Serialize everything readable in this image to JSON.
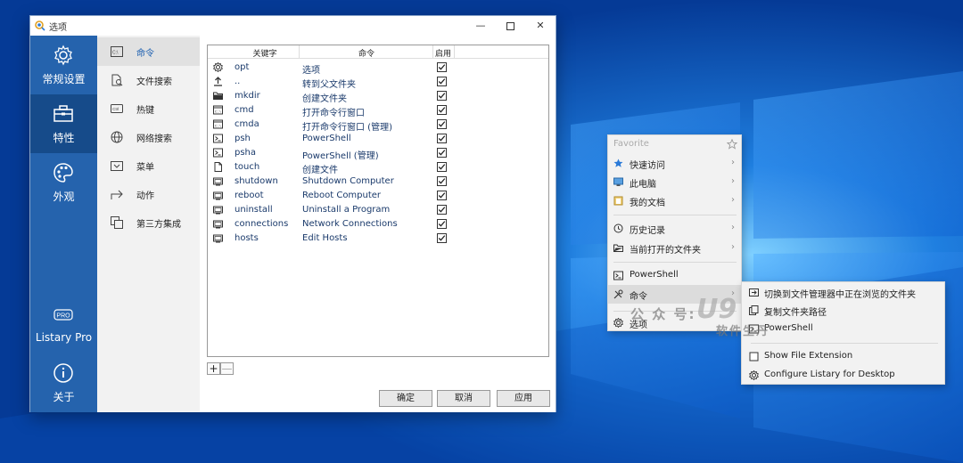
{
  "window": {
    "title": "选项",
    "controls": {
      "minimize": "—",
      "close": "✕"
    }
  },
  "main_nav": [
    {
      "label": "常规设置",
      "icon": "gear-icon"
    },
    {
      "label": "特性",
      "icon": "toolbox-icon",
      "active": true
    },
    {
      "label": "外观",
      "icon": "palette-icon"
    },
    {
      "label": "Listary Pro",
      "icon": "pro-badge-icon"
    },
    {
      "label": "关于",
      "icon": "info-icon"
    }
  ],
  "pro_badge": "PRO",
  "sub_nav": [
    {
      "label": "命令",
      "icon": "command-icon",
      "active": true
    },
    {
      "label": "文件搜索",
      "icon": "file-search-icon"
    },
    {
      "label": "热键",
      "icon": "hotkey-icon"
    },
    {
      "label": "网络搜索",
      "icon": "globe-icon"
    },
    {
      "label": "菜单",
      "icon": "menu-icon"
    },
    {
      "label": "动作",
      "icon": "action-icon"
    },
    {
      "label": "第三方集成",
      "icon": "integration-icon"
    }
  ],
  "subnav_icon_text": {
    "command": "C:\\",
    "hotkey": "Ctrl"
  },
  "table": {
    "headers": {
      "keyword": "关键字",
      "command": "命令",
      "enabled": "启用"
    },
    "rows": [
      {
        "keyword": "opt",
        "command": "选项",
        "icon": "gear-icon",
        "enabled": true
      },
      {
        "keyword": "..",
        "command": "转到父文件夹",
        "icon": "up-arrow-icon",
        "enabled": true
      },
      {
        "keyword": "mkdir",
        "command": "创建文件夹",
        "icon": "folder-icon",
        "enabled": true
      },
      {
        "keyword": "cmd",
        "command": "打开命令行窗口",
        "icon": "terminal-icon",
        "enabled": true
      },
      {
        "keyword": "cmda",
        "command": "打开命令行窗口 (管理)",
        "icon": "terminal-icon",
        "enabled": true
      },
      {
        "keyword": "psh",
        "command": "PowerShell",
        "icon": "powershell-icon",
        "enabled": true
      },
      {
        "keyword": "psha",
        "command": "PowerShell (管理)",
        "icon": "powershell-icon",
        "enabled": true
      },
      {
        "keyword": "touch",
        "command": "创建文件",
        "icon": "file-icon",
        "enabled": true
      },
      {
        "keyword": "shutdown",
        "command": "Shutdown Computer",
        "icon": "system-icon",
        "enabled": true
      },
      {
        "keyword": "reboot",
        "command": "Reboot Computer",
        "icon": "system-icon",
        "enabled": true
      },
      {
        "keyword": "uninstall",
        "command": "Uninstall a Program",
        "icon": "system-icon",
        "enabled": true
      },
      {
        "keyword": "connections",
        "command": "Network Connections",
        "icon": "system-icon",
        "enabled": true
      },
      {
        "keyword": "hosts",
        "command": "Edit Hosts",
        "icon": "system-icon",
        "enabled": true
      }
    ]
  },
  "table_buttons": {
    "add": "+",
    "remove": "—"
  },
  "buttons": {
    "ok": "确定",
    "cancel": "取消",
    "apply": "应用"
  },
  "context_menu": {
    "favorite_label": "Favorite",
    "items": [
      {
        "label": "快速访问",
        "icon": "star-icon",
        "arrow": "›"
      },
      {
        "label": "此电脑",
        "icon": "computer-icon",
        "arrow": "›"
      },
      {
        "label": "我的文档",
        "icon": "documents-icon",
        "arrow": "›"
      },
      {
        "label": "历史记录",
        "icon": "history-icon",
        "arrow": "›"
      },
      {
        "label": "当前打开的文件夹",
        "icon": "open-folder-icon",
        "arrow": "›"
      },
      {
        "label": "PowerShell",
        "icon": "powershell-icon"
      },
      {
        "label": "命令",
        "icon": "tools-icon",
        "arrow": "›",
        "highlighted": true
      },
      {
        "label": "选项",
        "icon": "gear-icon"
      }
    ]
  },
  "submenu": {
    "items": [
      {
        "label": "切换到文件管理器中正在浏览的文件夹",
        "icon": "switch-folder-icon"
      },
      {
        "label": "复制文件夹路径",
        "icon": "copy-path-icon"
      },
      {
        "label": "PowerShell",
        "icon": "powershell-icon"
      },
      {
        "label": "Show File Extension",
        "icon": "checkbox-icon"
      },
      {
        "label": "Configure Listary for Desktop",
        "icon": "gear-icon"
      }
    ]
  },
  "watermark": {
    "line1": "公 众 号:",
    "big": "U9",
    "line2": "软件生丹"
  },
  "colors": {
    "nav_blue": "#2563ad",
    "nav_active": "#164b8a",
    "desktop": "#0a4fb8",
    "link_text": "#1a3a6b"
  }
}
